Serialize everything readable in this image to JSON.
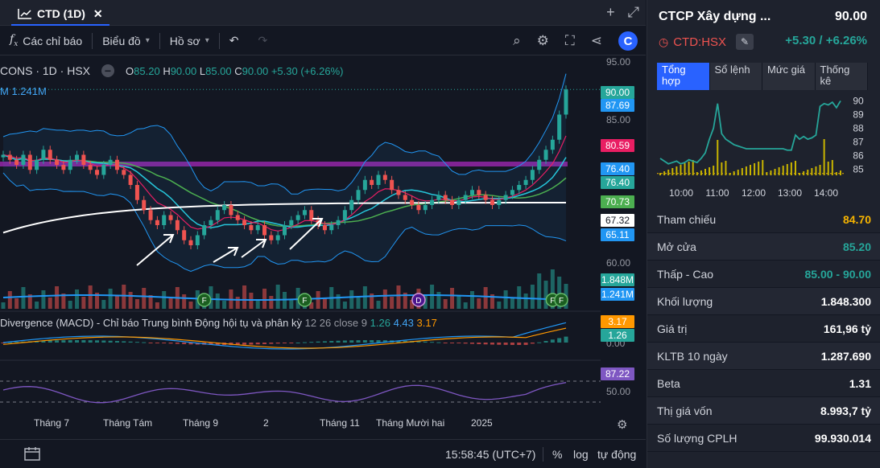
{
  "tab": {
    "title": "CTD (1D)"
  },
  "toolbar": {
    "indicators_label": "Các chỉ báo",
    "chart_label": "Biểu đồ",
    "profile_label": "Hồ sơ"
  },
  "legend": {
    "symbol": "CONS · 1D · HSX",
    "o_label": "O",
    "o": "85.20",
    "h_label": "H",
    "h": "90.00",
    "l_label": "L",
    "l": "85.00",
    "c_label": "C",
    "c": "90.00",
    "change": "+5.30 (+6.26%)",
    "volume": "M 1.241M"
  },
  "macd_legend": {
    "title": "Divergence (MACD) - Chỉ báo Trung bình Động hội tụ và phân kỳ",
    "params": "12 26 close 9",
    "v1": "1.26",
    "v2": "4.43",
    "v3": "3.17"
  },
  "price_axis": {
    "labels": [
      "95.00",
      "85.00",
      "60.00"
    ],
    "badges": [
      {
        "text": "90.00",
        "color": "#26a69a"
      },
      {
        "text": "87.69",
        "color": "#2196f3"
      },
      {
        "text": "80.59",
        "color": "#e91e63"
      },
      {
        "text": "76.40",
        "color": "#2196f3"
      },
      {
        "text": "76.40",
        "color": "#26a69a"
      },
      {
        "text": "70.73",
        "color": "#4caf50"
      },
      {
        "text": "67.32",
        "color": "#ffffff"
      },
      {
        "text": "65.11",
        "color": "#2196f3"
      },
      {
        "text": "1.848M",
        "color": "#26a69a"
      },
      {
        "text": "1.241M",
        "color": "#2196f3"
      },
      {
        "text": "3.17",
        "color": "#ff9800"
      },
      {
        "text": "1.26",
        "color": "#26a69a"
      },
      {
        "text": "87.22",
        "color": "#7e57c2"
      }
    ],
    "macd_zero": "0.00",
    "rsi_label": "50.00"
  },
  "time_axis": [
    "Tháng 7",
    "Tháng Tám",
    "Tháng 9",
    "2",
    "Tháng 11",
    "Tháng Mười hai",
    "2025"
  ],
  "bottom": {
    "clock": "15:58:45 (UTC+7)",
    "percent": "%",
    "log": "log",
    "auto": "tự động"
  },
  "chart_data": {
    "type": "candlestick",
    "ylim": [
      55,
      95
    ],
    "close": [
      77,
      76,
      75,
      77,
      74,
      76,
      78,
      76,
      75,
      74,
      76,
      77,
      75,
      74,
      73,
      75,
      76,
      74,
      73,
      71,
      68,
      66,
      64,
      63,
      65,
      64,
      62,
      60,
      59,
      61,
      63,
      64,
      66,
      67,
      65,
      64,
      63,
      62,
      63,
      61,
      60,
      61,
      63,
      64,
      65,
      66,
      64,
      63,
      62,
      63,
      64,
      66,
      68,
      70,
      72,
      71,
      73,
      72,
      70,
      69,
      68,
      67,
      66,
      67,
      68,
      69,
      68,
      67,
      68,
      69,
      70,
      69,
      68,
      67,
      68,
      69,
      70,
      71,
      72,
      74,
      76,
      78,
      80,
      85,
      90
    ],
    "markers": [
      {
        "label": "F",
        "index": 30
      },
      {
        "label": "F",
        "index": 45
      },
      {
        "label": "D",
        "index": 62
      },
      {
        "label": "F",
        "index": 82
      },
      {
        "label": "F",
        "index": 84
      }
    ]
  },
  "panel": {
    "title": "CTCP Xây dựng ...",
    "price": "90.00",
    "ticker": "CTD:HSX",
    "change": "+5.30 / +6.26%",
    "tabs": [
      "Tổng hợp",
      "Sổ lệnh",
      "Mức giá",
      "Thống kê"
    ],
    "intraday": {
      "y_labels": [
        "90",
        "89",
        "88",
        "87",
        "86",
        "85"
      ],
      "x_labels": [
        "10:00",
        "11:00",
        "12:00",
        "13:00",
        "14:00"
      ],
      "prices": [
        85.8,
        85.6,
        85.4,
        85.5,
        85.6,
        85.4,
        85.5,
        85.7,
        85.6,
        85.5,
        85.8,
        86.2,
        87.2,
        88.0,
        89.8,
        87.6,
        87.2,
        87.0,
        86.8,
        86.7,
        86.6,
        86.5,
        86.5,
        86.5,
        86.5,
        86.5,
        86.5,
        86.5,
        86.5,
        86.5,
        86.5,
        86.4,
        86.4,
        87.5,
        87.2,
        87.4,
        87.2,
        87.3,
        87.5,
        89.6,
        89.8,
        89.7,
        89.9,
        89.5,
        90.0
      ]
    },
    "rows": [
      {
        "label": "Tham chiếu",
        "value": "84.70",
        "style": "yellow"
      },
      {
        "label": "Mở cửa",
        "value": "85.20",
        "style": "green"
      },
      {
        "label": "Thấp - Cao",
        "value": "85.00 - 90.00",
        "style": "green"
      },
      {
        "label": "Khối lượng",
        "value": "1.848.300",
        "style": ""
      },
      {
        "label": "Giá trị",
        "value": "161,96 tỷ",
        "style": ""
      },
      {
        "label": "KLTB 10 ngày",
        "value": "1.287.690",
        "style": ""
      },
      {
        "label": "Beta",
        "value": "1.31",
        "style": ""
      },
      {
        "label": "Thị giá vốn",
        "value": "8.993,7 tỷ",
        "style": ""
      },
      {
        "label": "Số lượng CPLH",
        "value": "99.930.014",
        "style": ""
      }
    ]
  }
}
